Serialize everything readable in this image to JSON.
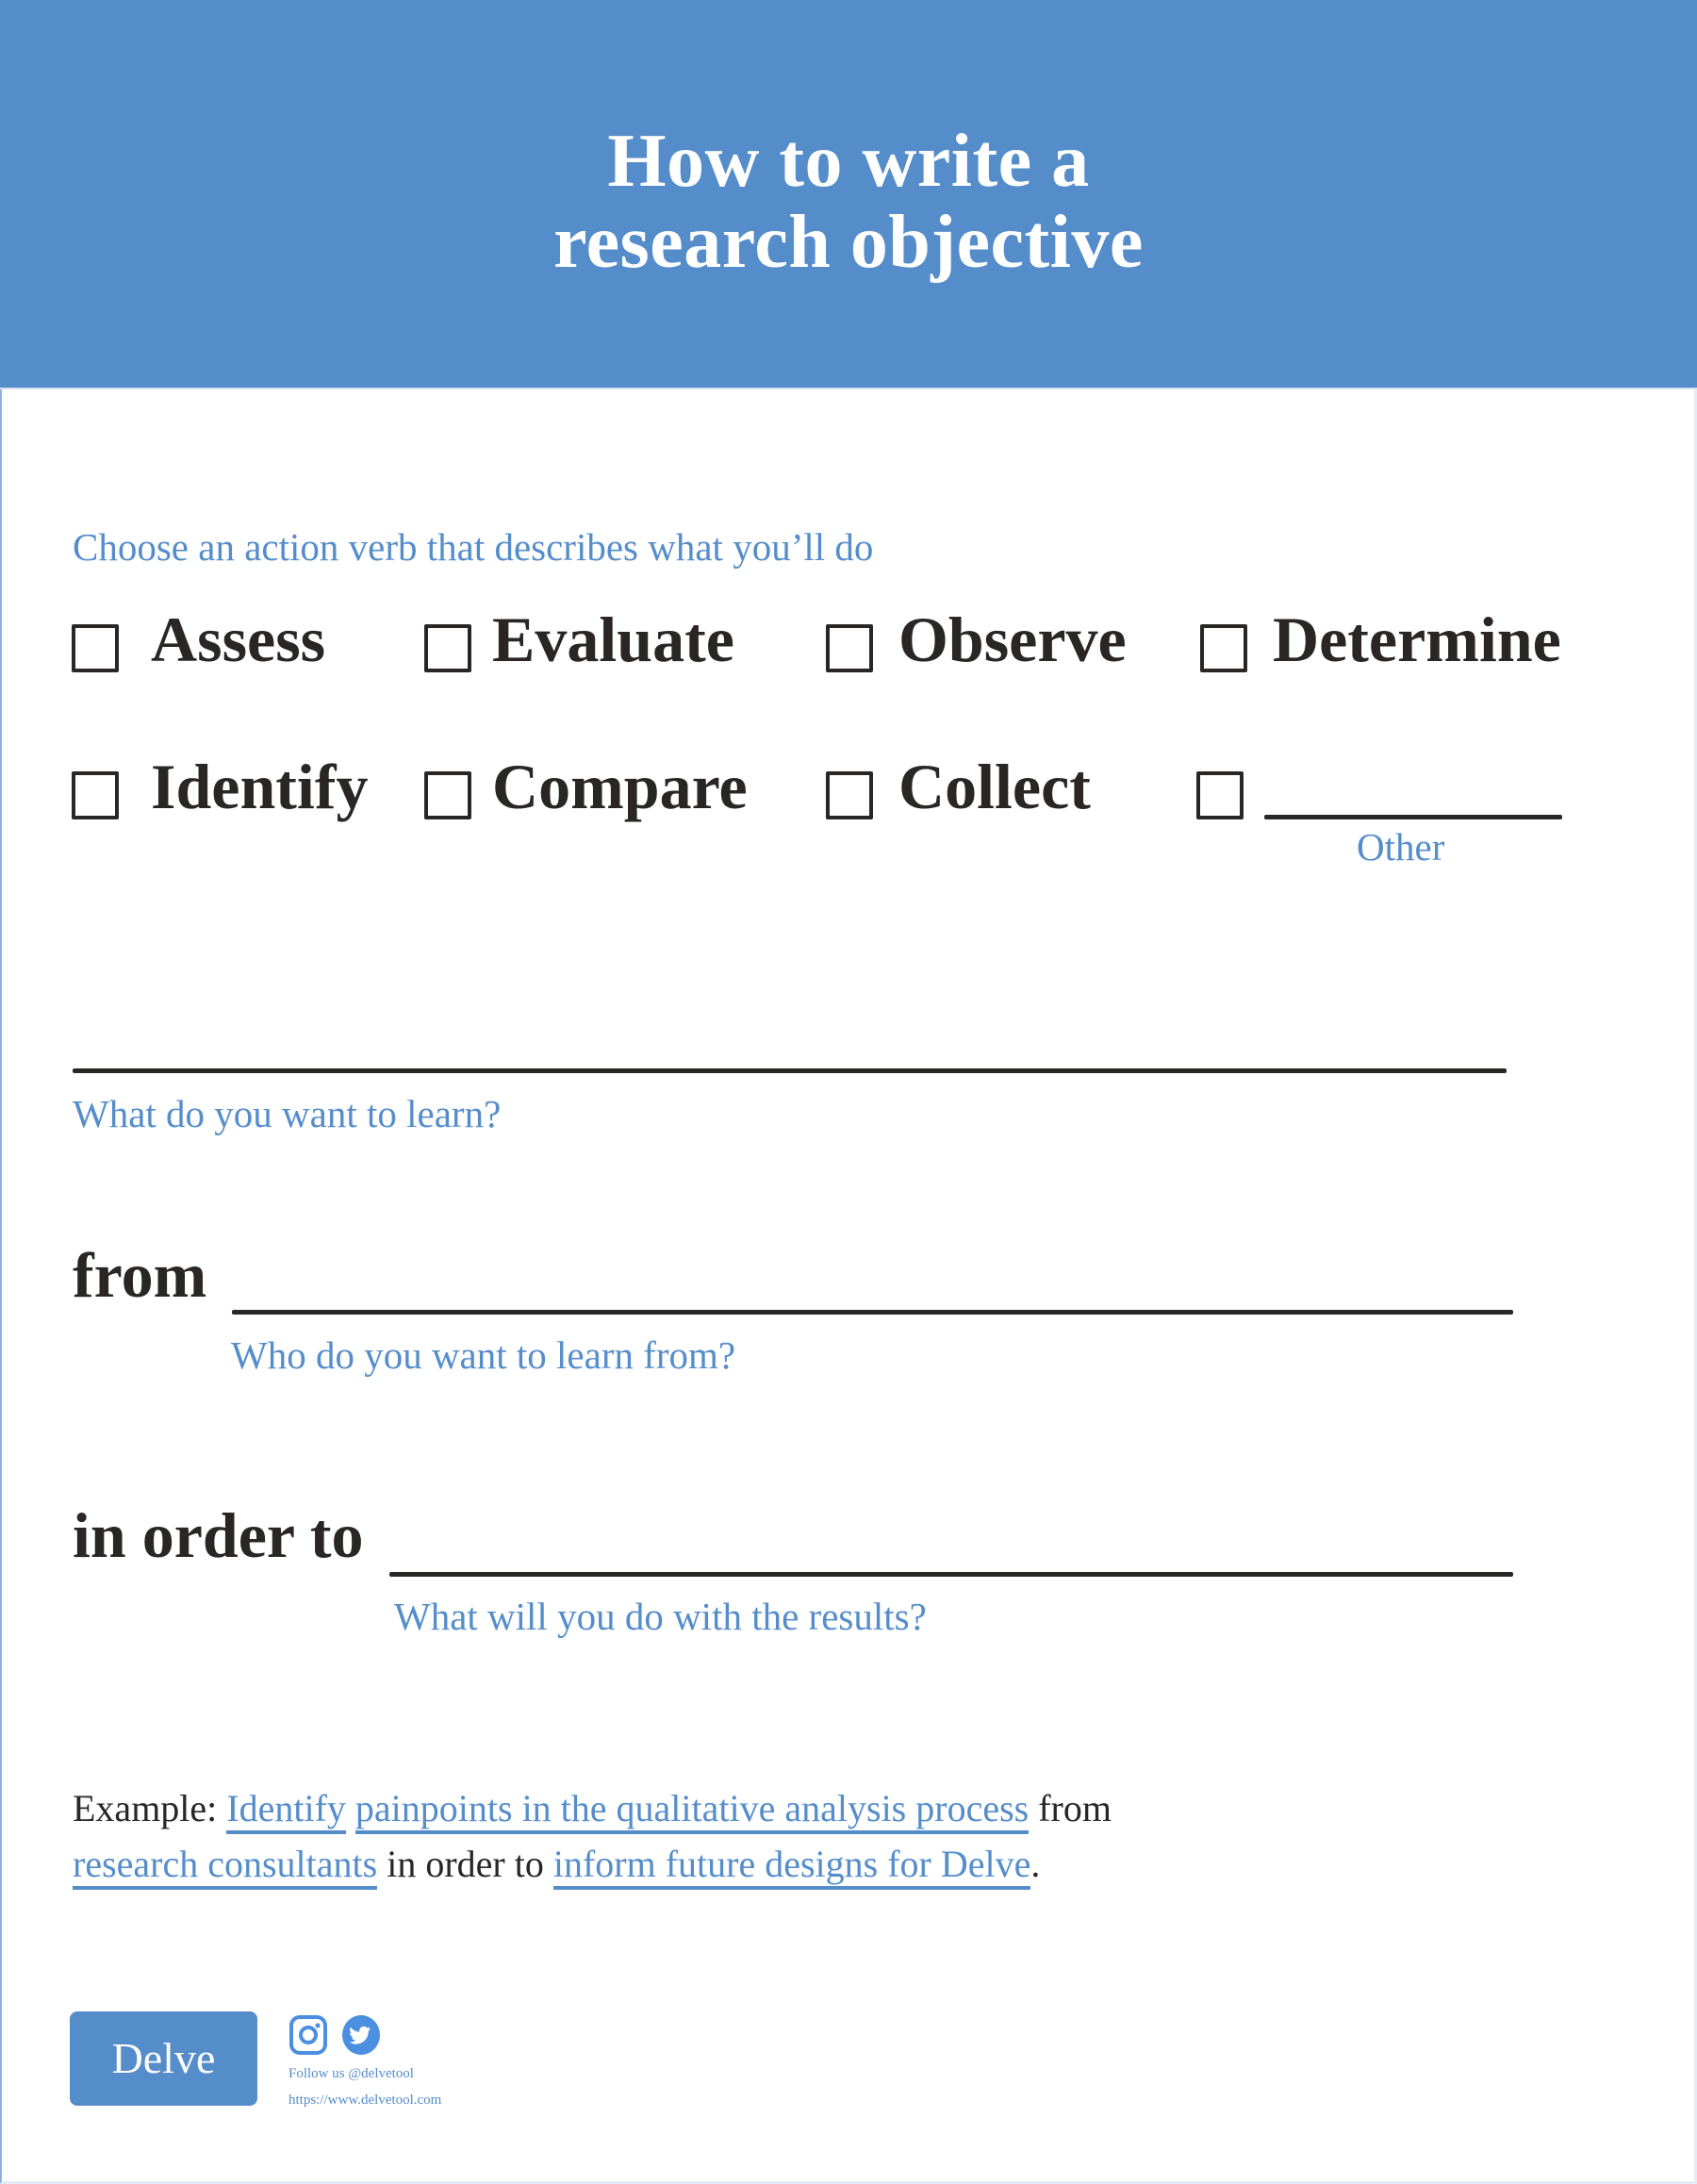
{
  "header": {
    "title_line1": "How to write a",
    "title_line2": "research objective",
    "background_color": "#558dcb"
  },
  "verbs": {
    "instruction": "Choose an action verb that describes what you’ll do",
    "options": [
      {
        "label": "Assess",
        "checked": false
      },
      {
        "label": "Evaluate",
        "checked": false
      },
      {
        "label": "Observe",
        "checked": false
      },
      {
        "label": "Determine",
        "checked": false
      },
      {
        "label": "Identify",
        "checked": false
      },
      {
        "label": "Compare",
        "checked": false
      },
      {
        "label": "Collect",
        "checked": false
      }
    ],
    "other": {
      "label": "Other",
      "value": "",
      "checked": false
    }
  },
  "fields": {
    "learn": {
      "hint": "What do you want to learn?",
      "value": ""
    },
    "from": {
      "connector": "from",
      "hint": "Who do you want to learn from?",
      "value": ""
    },
    "in_order_to": {
      "connector": "in order to",
      "hint": "What will you do with the results?",
      "value": ""
    }
  },
  "example": {
    "prefix": "Example:",
    "verb": "Identify",
    "learn": "painpoints in the qualitative analysis process",
    "from_word": "from",
    "who": "research consultants",
    "in_order_to_word": "in order to",
    "result": "inform future designs for Delve",
    "end": "."
  },
  "footer": {
    "logo_text": "Delve",
    "icons": [
      "instagram-icon",
      "twitter-icon"
    ],
    "follow_text": "Follow us @delvetool",
    "url_text": "https://www.delvetool.com"
  },
  "colors": {
    "accent": "#558dcb",
    "text": "#2a2626",
    "background": "#ffffff"
  }
}
